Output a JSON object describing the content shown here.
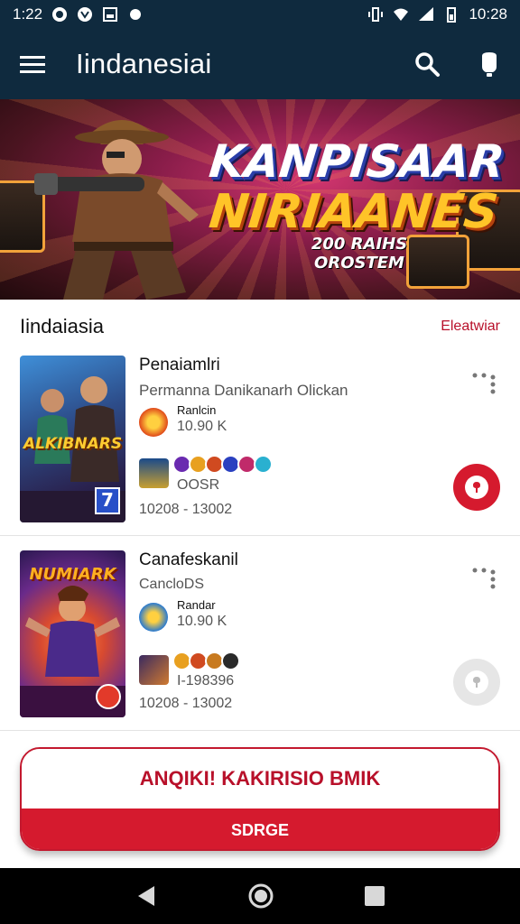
{
  "statusbar": {
    "time_left": "1:22",
    "time_right": "10:28"
  },
  "appbar": {
    "title": "Iindanesiai"
  },
  "banner": {
    "line1": "KANPISAAR",
    "line2": "NIRIAANES",
    "line3": "200 RAIHS OROSTEM"
  },
  "section": {
    "title": "Iindaiasia",
    "more": "Eleatwiar"
  },
  "cards": [
    {
      "name": "Penaiamlri",
      "subtitle": "Permanna Danikanarh Olickan",
      "rating_label": "Ranlcin",
      "rating_value": "10.90 K",
      "code": "OOSR",
      "range": "10208 - 13002",
      "thumb_title": "ALKIBNARS",
      "thumb_badge": "7"
    },
    {
      "name": "Canafeskanil",
      "subtitle": "CancloDS",
      "rating_label": "Randar",
      "rating_value": "10.90 K",
      "code": "I-198396",
      "range": "10208 - 13002",
      "thumb_title": "NUMIARK",
      "thumb_badge": ""
    }
  ],
  "cta": {
    "headline": "ANQIKI! KAKIRISIO BMIK",
    "button": "SDRGE"
  },
  "colors": {
    "primary": "#0f2a3e",
    "accent": "#d51a2e",
    "accent_text": "#b8102a"
  }
}
